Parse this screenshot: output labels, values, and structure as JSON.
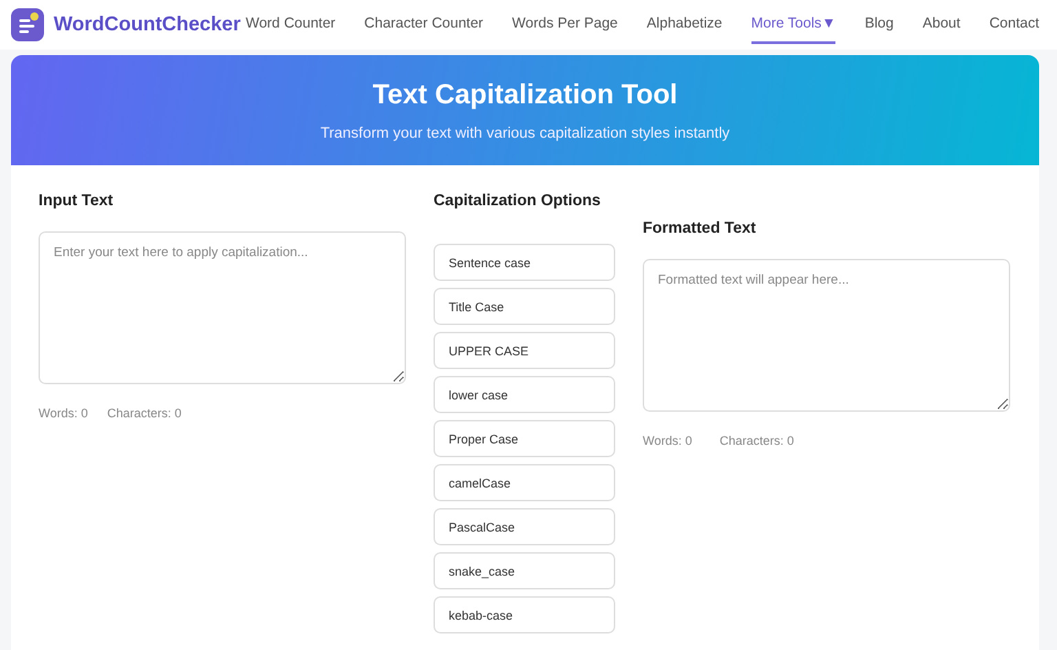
{
  "brand": "WordCountChecker",
  "nav": [
    {
      "label": "Word Counter",
      "selected": false
    },
    {
      "label": "Character Counter",
      "selected": false
    },
    {
      "label": "Words Per Page",
      "selected": false
    },
    {
      "label": "Alphabetize",
      "selected": false
    },
    {
      "label": "More Tools",
      "selected": true,
      "dropdown": "▼"
    },
    {
      "label": "Blog",
      "selected": false
    },
    {
      "label": "About",
      "selected": false
    },
    {
      "label": "Contact",
      "selected": false
    }
  ],
  "banner": {
    "title": "Text Capitalization Tool",
    "subtitle": "Transform your text with various capitalization styles instantly"
  },
  "input": {
    "heading": "Input Text",
    "placeholder": "Enter your text here to apply capitalization...",
    "words": "Words: 0",
    "characters": "Characters: 0"
  },
  "options": {
    "heading": "Capitalization Options",
    "buttons": [
      "Sentence case",
      "Title Case",
      "UPPER CASE",
      "lower case",
      "Proper Case",
      "camelCase",
      "PascalCase",
      "snake_case",
      "kebab-case"
    ]
  },
  "output": {
    "heading": "Formatted Text",
    "placeholder": "Formatted text will appear here...",
    "words": "Words: 0",
    "characters": "Characters: 0"
  }
}
